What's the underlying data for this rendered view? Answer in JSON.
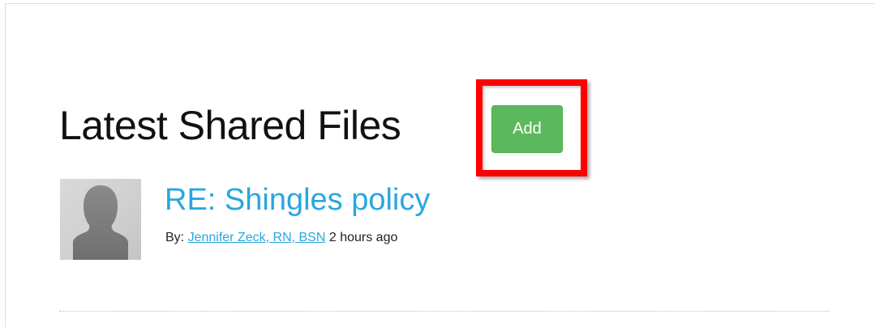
{
  "shared_files": {
    "heading": "Latest Shared Files",
    "add_label": "Add",
    "items": [
      {
        "title": "RE: Shingles policy",
        "by_label": "By:",
        "author": "Jennifer Zeck, RN, BSN",
        "time_ago": "2 hours ago",
        "avatar_icon": "default-user-avatar-icon"
      }
    ]
  },
  "colors": {
    "add_button": "#5cb85c",
    "link": "#2aa6de",
    "highlight": "#ff0000"
  }
}
